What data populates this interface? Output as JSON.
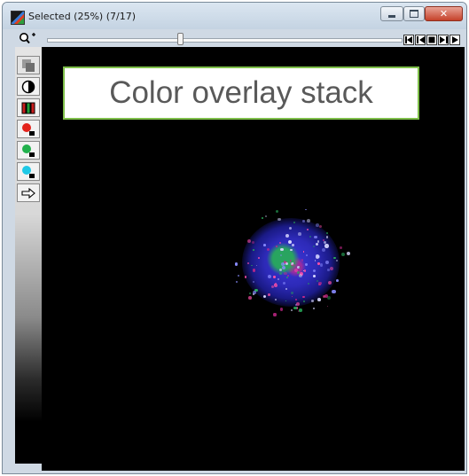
{
  "window": {
    "title": "Selected (25%) (7/17)",
    "close_glyph": "✕"
  },
  "navigation": {
    "slice_current": 7,
    "slice_total": 17
  },
  "toolbar": {
    "tools": [
      "zoom-icon",
      "rectangle-select-icon",
      "contrast-icon",
      "channels-icon",
      "red-channel-icon",
      "green-channel-icon",
      "cyan-channel-icon",
      "arrow-right-icon"
    ]
  },
  "canvas": {
    "overlay_label": "Color overlay stack"
  },
  "colors": {
    "canvas_bg": "#000000",
    "label_border": "#7fbf4a",
    "label_text": "#595959",
    "nucleus_blue": "#3b37d8",
    "cluster_green": "#28aa5a",
    "speck_magenta": "#c8288c"
  }
}
